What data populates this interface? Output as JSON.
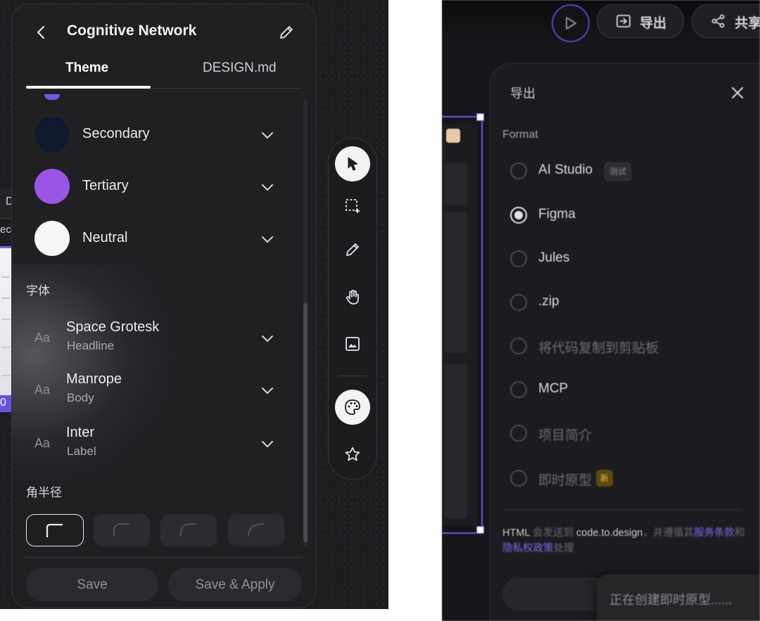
{
  "left_panel": {
    "title": "Cognitive Network",
    "tabs": [
      {
        "label": "Theme",
        "active": true
      },
      {
        "label": "DESIGN.md",
        "active": false
      }
    ],
    "colors": [
      {
        "label": "Secondary",
        "swatch": "#0f1a2e"
      },
      {
        "label": "Tertiary",
        "swatch": "#9b55e6"
      },
      {
        "label": "Neutral",
        "swatch": "#f6f6f8"
      }
    ],
    "fonts_section": "字体",
    "fonts": [
      {
        "icon": "Aa",
        "name": "Space Grotesk",
        "role": "Headline"
      },
      {
        "icon": "Aa",
        "name": "Manrope",
        "role": "Body"
      },
      {
        "icon": "Aa",
        "name": "Inter",
        "role": "Label"
      }
    ],
    "radius_section": "角半径",
    "radius_selected_index": 0,
    "buttons": {
      "save": "Save",
      "save_apply": "Save & Apply"
    }
  },
  "background_fragments": {
    "d": "D",
    "e": "ec",
    "zero": "0"
  },
  "toolbar": {
    "tools": [
      "pointer-icon",
      "marquee-select-icon",
      "pencil-icon",
      "hand-icon",
      "image-icon",
      "palette-icon",
      "star-icon"
    ],
    "active_tools": [
      "pointer-icon",
      "palette-icon"
    ]
  },
  "right_panel": {
    "top_buttons": {
      "export": "导出",
      "share": "共享"
    },
    "dialog_title": "导出",
    "format_label": "Format",
    "options": [
      {
        "label": "AI Studio",
        "tag": "测试",
        "selected": false,
        "dim": false
      },
      {
        "label": "Figma",
        "selected": true,
        "dim": false
      },
      {
        "label": "Jules",
        "selected": false,
        "dim": false
      },
      {
        "label": ".zip",
        "selected": false,
        "dim": false
      },
      {
        "label": "将代码复制到剪贴板",
        "selected": false,
        "dim": true
      },
      {
        "label": "MCP",
        "selected": false,
        "dim": false
      },
      {
        "label": "项目简介",
        "selected": false,
        "dim": true
      },
      {
        "label": "即时原型",
        "tag": "新",
        "selected": false,
        "dim": true
      }
    ],
    "footer": {
      "p1": "HTML",
      "p2": " 会发送到 ",
      "p3": "code.to.design",
      "p4": "，并遵循其",
      "link1": "服务条款",
      "p5": "和",
      "link2": "隐私权政策",
      "p6": "处理"
    },
    "toast": "正在创建即时原型......"
  },
  "colors": {
    "accent": "#6b57e0",
    "panel": "#202023",
    "dialog": "#1c1c20"
  }
}
